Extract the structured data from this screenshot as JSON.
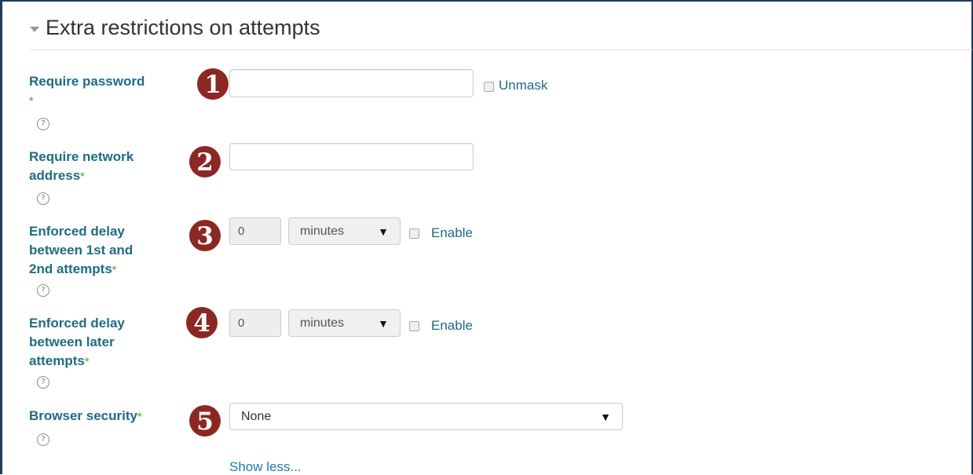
{
  "section": {
    "title": "Extra restrictions on attempts"
  },
  "fields": {
    "password": {
      "label": "Require password",
      "required_mark": "*",
      "help": "?",
      "badge": "1",
      "value": "",
      "unmask_label": "Unmask"
    },
    "network": {
      "label_line1": "Require network",
      "label_line2": "address",
      "required_mark": "*",
      "help": "?",
      "badge": "2",
      "value": ""
    },
    "delay1": {
      "label_line1": "Enforced delay",
      "label_line2": "between 1st and",
      "label_line3": "2nd attempts",
      "required_mark": "*",
      "help": "?",
      "badge": "3",
      "value": "0",
      "unit": "minutes",
      "caret": "▼",
      "enable_label": "Enable"
    },
    "delay2": {
      "label_line1": "Enforced delay",
      "label_line2": "between later",
      "label_line3": "attempts",
      "required_mark": "*",
      "help": "?",
      "badge": "4",
      "value": "0",
      "unit": "minutes",
      "caret": "▼",
      "enable_label": "Enable"
    },
    "browser": {
      "label": "Browser security",
      "required_mark": "*",
      "help": "?",
      "badge": "5",
      "value": "None",
      "caret": "▼"
    }
  },
  "show_less": "Show less...",
  "colors": {
    "label": "#1f6b84",
    "required": "#6cbf4f",
    "badge": "#8b2823",
    "link": "#1f7ab0",
    "frame": "#1f3b5c"
  },
  "icons": {
    "collapse": "triangle-down-icon",
    "help": "question-circle-icon"
  }
}
